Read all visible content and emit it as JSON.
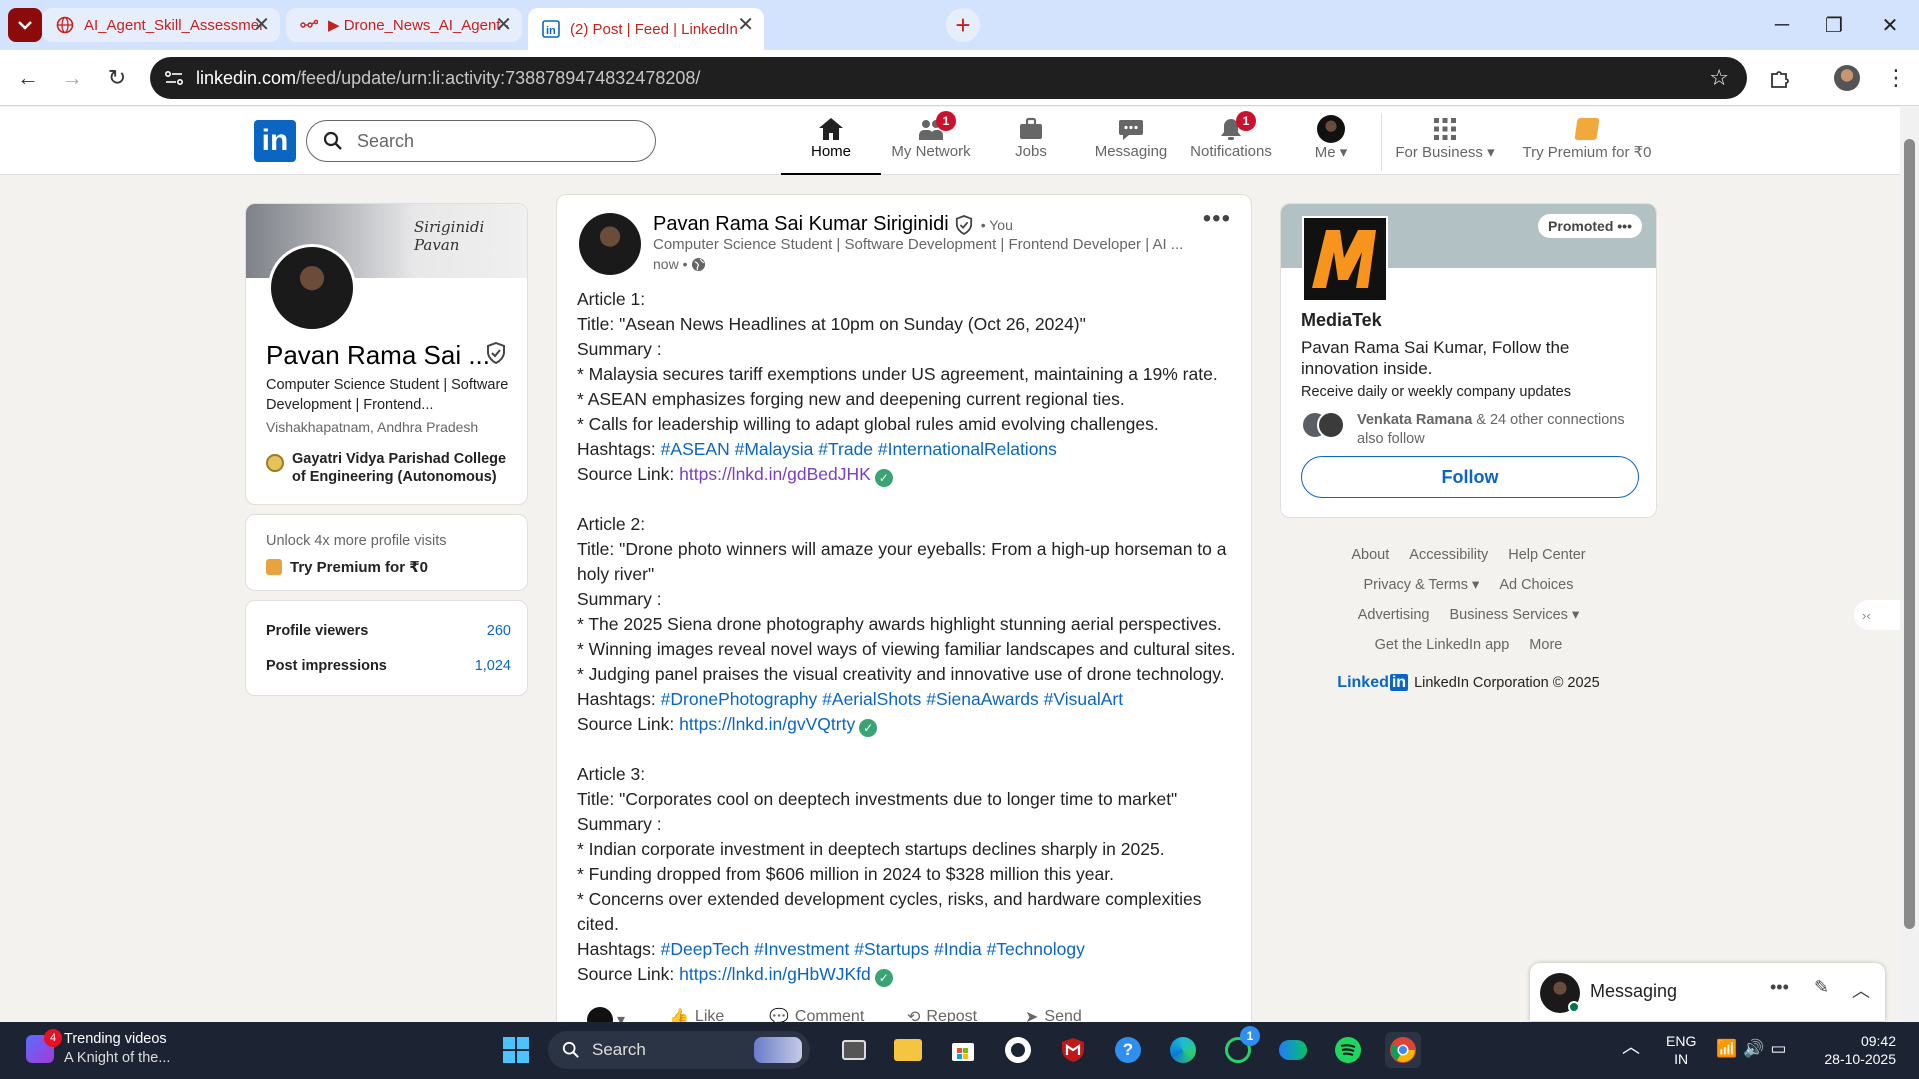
{
  "browser": {
    "tabs": [
      {
        "title": "AI_Agent_Skill_Assessment_Task"
      },
      {
        "title": "▶ Drone_News_AI_Agent - n8n"
      },
      {
        "title": "(2) Post | Feed | LinkedIn"
      }
    ],
    "url_host": "linkedin.com",
    "url_path": "/feed/update/urn:li:activity:7388789474832478208/"
  },
  "nav": {
    "search_placeholder": "Search",
    "items": [
      {
        "label": "Home"
      },
      {
        "label": "My Network",
        "badge": "1"
      },
      {
        "label": "Jobs"
      },
      {
        "label": "Messaging"
      },
      {
        "label": "Notifications",
        "badge": "1"
      },
      {
        "label": "Me"
      },
      {
        "label": "For Business"
      },
      {
        "label": "Try Premium for ₹0"
      }
    ]
  },
  "profile": {
    "banner_sign": "Siriginidi Pavan",
    "name": "Pavan Rama Sai ...",
    "headline": "Computer Science Student | Software Development | Frontend...",
    "location": "Vishakhapatnam, Andhra Pradesh",
    "school": "Gayatri Vidya Parishad College of Engineering (Autonomous)",
    "premium_line1": "Unlock 4x more profile visits",
    "premium_line2": "Try Premium for ₹0",
    "stats": [
      {
        "label": "Profile viewers",
        "value": "260"
      },
      {
        "label": "Post impressions",
        "value": "1,024"
      }
    ]
  },
  "post": {
    "author": "Pavan Rama Sai Kumar Siriginidi",
    "you": "• You",
    "headline": "Computer Science Student | Software Development | Frontend Developer | AI ...",
    "time": "now •",
    "articles": [
      {
        "heading": "Article 1:",
        "title": "Title: \"Asean News Headlines at 10pm on Sunday (Oct 26, 2024)\"",
        "summary_label": "Summary :",
        "bullets": [
          "* Malaysia secures tariff exemptions under US agreement, maintaining a 19% rate.",
          "* ASEAN emphasizes forging new and deepening current regional ties.",
          "* Calls for leadership willing to adapt global rules amid evolving challenges."
        ],
        "hashtags_label": "Hashtags:",
        "hashtags": "#ASEAN #Malaysia #Trade #InternationalRelations",
        "source_label": "Source Link:",
        "source": "https://lnkd.in/gdBedJHK"
      },
      {
        "heading": "Article 2:",
        "title": "Title: \"Drone photo winners will amaze your eyeballs: From a high-up horseman to a holy river\"",
        "summary_label": "Summary :",
        "bullets": [
          "* The 2025 Siena drone photography awards highlight stunning aerial perspectives.",
          "* Winning images reveal novel ways of viewing familiar landscapes and cultural sites.",
          "* Judging panel praises the visual creativity and innovative use of drone technology."
        ],
        "hashtags_label": "Hashtags:",
        "hashtags": "#DronePhotography #AerialShots #SienaAwards #VisualArt",
        "source_label": "Source Link:",
        "source": "https://lnkd.in/gvVQtrty"
      },
      {
        "heading": "Article 3:",
        "title": "Title: \"Corporates cool on deeptech investments due to longer time to market\"",
        "summary_label": "Summary :",
        "bullets": [
          "* Indian corporate investment in deeptech startups declines sharply in 2025.",
          "* Funding dropped from $606 million in 2024 to $328 million this year.",
          "* Concerns over extended development cycles, risks, and hardware complexities cited."
        ],
        "hashtags_label": "Hashtags:",
        "hashtags": "#DeepTech #Investment #Startups #India #Technology",
        "source_label": "Source Link:",
        "source": "https://lnkd.in/gHbWJKfd"
      }
    ],
    "actions": [
      "Like",
      "Comment",
      "Repost",
      "Send"
    ]
  },
  "ad": {
    "promoted": "Promoted",
    "company": "MediaTek",
    "text": "Pavan Rama Sai Kumar, Follow the innovation inside.",
    "sub": "Receive daily or weekly company updates",
    "conn_name": "Venkata Ramana",
    "conn_rest": "& 24 other connections also follow",
    "follow": "Follow"
  },
  "footer": {
    "row1": [
      "About",
      "Accessibility",
      "Help Center"
    ],
    "row2": [
      "Privacy & Terms",
      "Ad Choices"
    ],
    "row3": [
      "Advertising",
      "Business Services"
    ],
    "row4": [
      "Get the LinkedIn app",
      "More"
    ],
    "copyright": "LinkedIn Corporation © 2025"
  },
  "messaging": {
    "title": "Messaging"
  },
  "taskbar": {
    "widget_badge": "4",
    "widget_title": "Trending videos",
    "widget_sub": "A Knight of the...",
    "search": "Search",
    "whatsapp_badge": "1",
    "lang1": "ENG",
    "lang2": "IN",
    "time": "09:42",
    "date": "28-10-2025"
  },
  "colors": {
    "linkedin_blue": "#0a66c2",
    "badge_red": "#cb112d"
  }
}
